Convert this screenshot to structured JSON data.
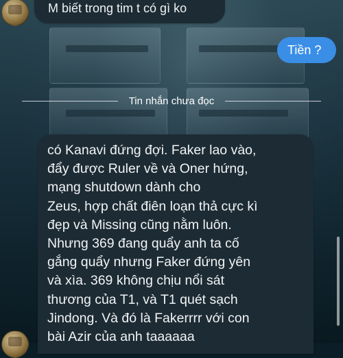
{
  "chat": {
    "messages": [
      {
        "from": "other",
        "text": "M biết trong tim t có gì ko"
      },
      {
        "from": "me",
        "text": "Tiền ?"
      }
    ],
    "unread_divider": "Tin nhắn chưa đọc",
    "long_message": {
      "from": "other",
      "lines": [
        "có Kanavi đứng đợi. Faker lao vào,",
        "đẩy được Ruler về và Oner hứng,",
        "mạng shutdown dành cho",
        "Zeus, hợp chất điên loạn thả cực kì",
        "đẹp và Missing cũng nằm luôn.",
        "Nhưng 369 đang quẩy anh ta cố",
        "gắng quẩy nhưng Faker đứng yên",
        "và xìa. 369 không chịu nổi sát",
        "thương của T1, và T1 quét sạch",
        "Jindong. Và đó là Fakerrrr với con",
        "bài Azir của anh taaaaaa"
      ]
    }
  },
  "colors": {
    "incoming_bubble": "#1d2b34",
    "outgoing_bubble": "#3a8ee6",
    "text": "#eef2f4"
  }
}
